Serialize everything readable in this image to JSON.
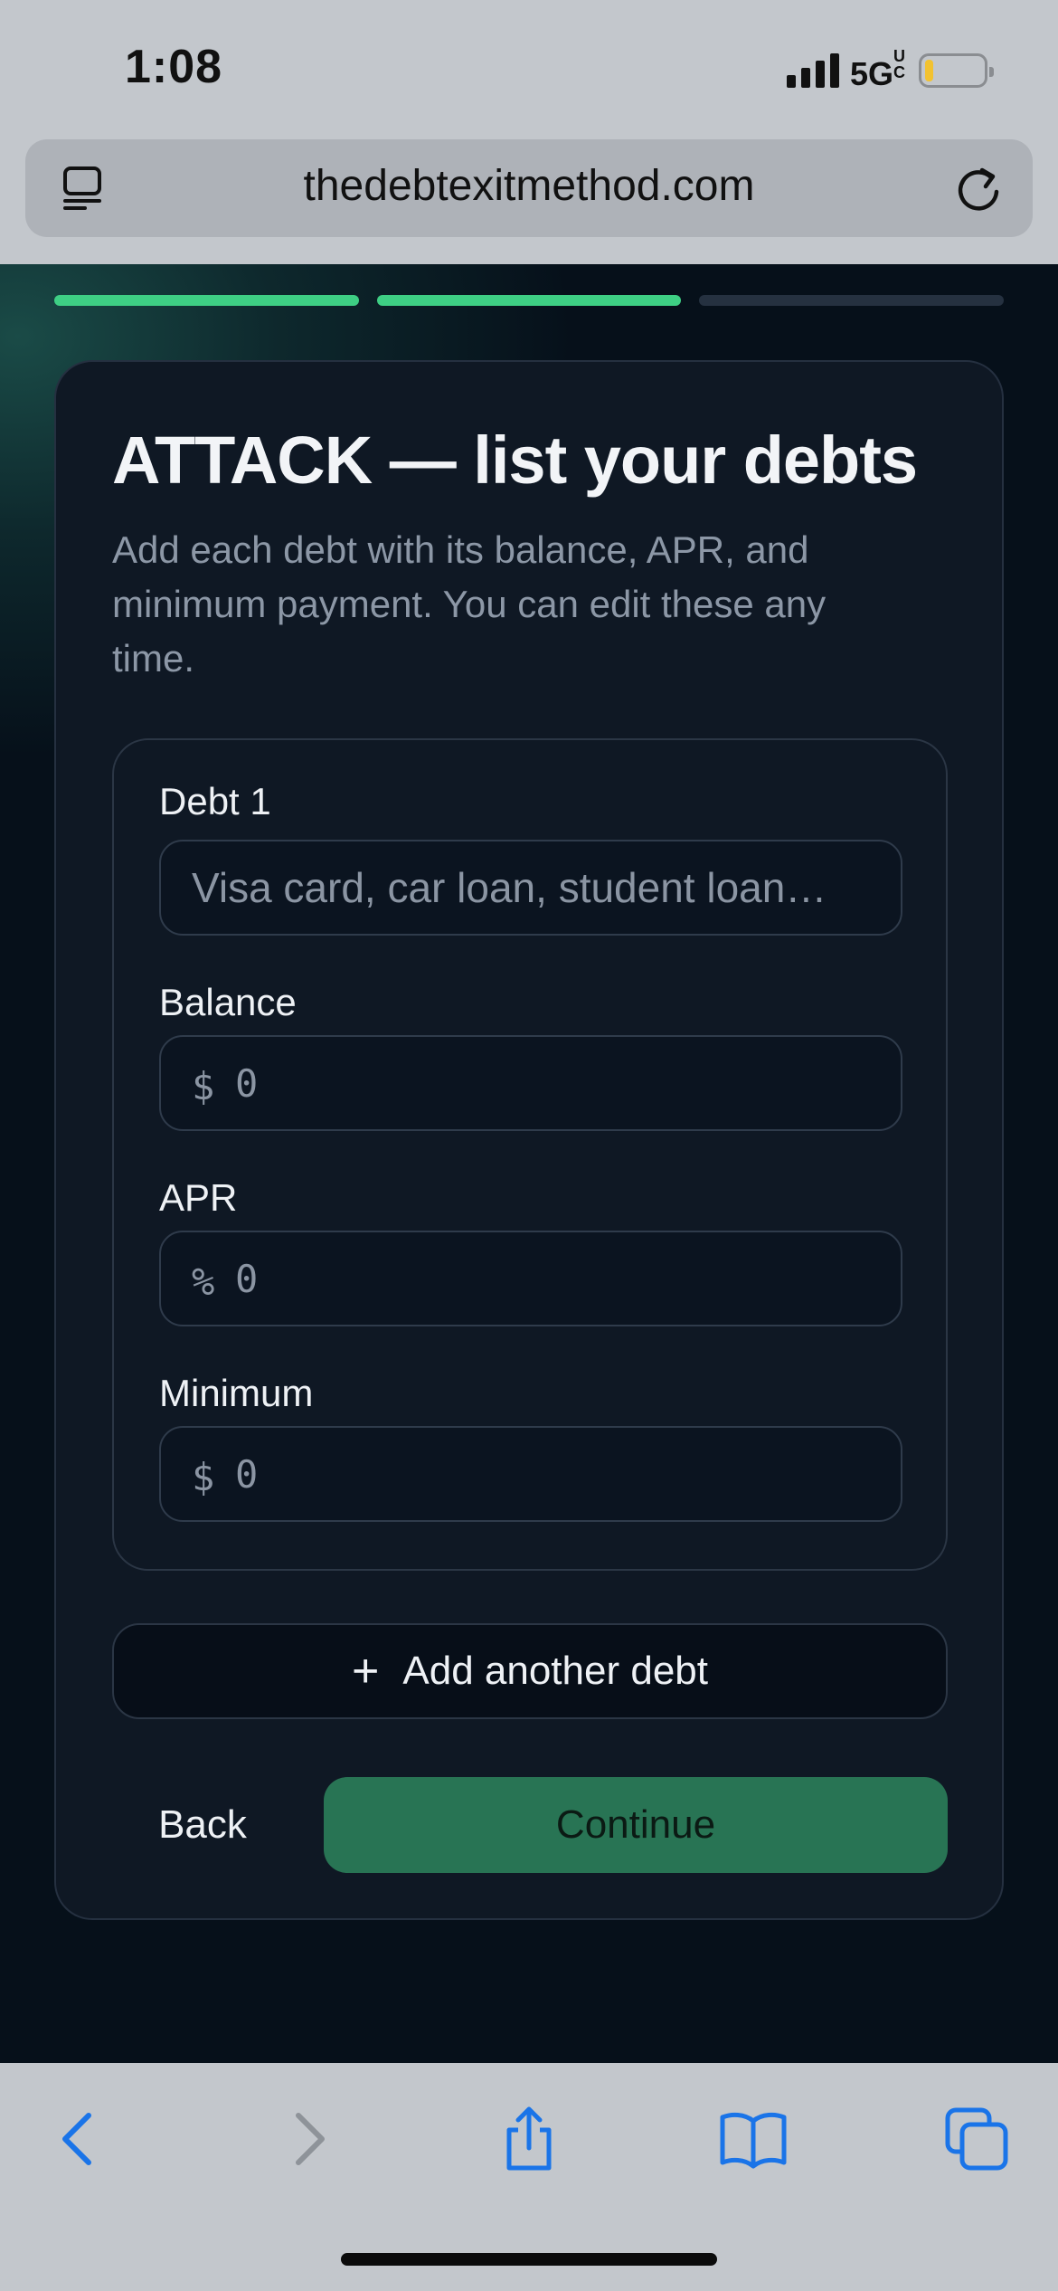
{
  "status_bar": {
    "time": "1:08",
    "network": "5G",
    "network_suffix": "UC",
    "battery_level": 0.15
  },
  "browser": {
    "url": "thedebtexitmethod.com",
    "icons": [
      "tab-overview-icon",
      "reload-icon",
      "back-arrow-icon",
      "forward-arrow-icon",
      "share-icon",
      "bookmarks-icon",
      "tabs-icon"
    ]
  },
  "progress": {
    "steps": [
      {
        "state": "complete",
        "color": "#3ecf84"
      },
      {
        "state": "complete",
        "color": "#3ecf84"
      },
      {
        "state": "incomplete",
        "color": "#253140"
      }
    ]
  },
  "card": {
    "title": "ATTACK — list your debts",
    "subtitle": "Add each debt with its balance, APR, and minimum payment. You can edit these any time."
  },
  "debt": {
    "name_label": "Debt 1",
    "name_placeholder": "Visa card, car loan, student loan…",
    "balance_label": "Balance",
    "balance_prefix": "$",
    "balance_placeholder": "0",
    "apr_label": "APR",
    "apr_prefix": "%",
    "apr_placeholder": "0",
    "minimum_label": "Minimum",
    "minimum_prefix": "$",
    "minimum_placeholder": "0"
  },
  "actions": {
    "add_icon": "plus-icon",
    "add_label": "Add another debt",
    "back_label": "Back",
    "continue_label": "Continue"
  },
  "colors": {
    "accent": "#3ecf84",
    "continue_bg": "#287454",
    "card_bg": "#0f1824",
    "browser_icon": "#1a74e8"
  }
}
